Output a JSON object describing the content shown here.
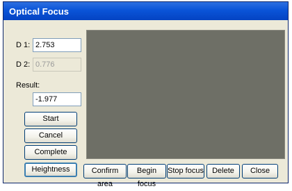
{
  "window": {
    "title": "Optical Focus"
  },
  "fields": {
    "d1": {
      "label": "D 1:",
      "value": "2.753"
    },
    "d2": {
      "label": "D 2:",
      "value": "0.776"
    },
    "result": {
      "label": "Result:",
      "value": "-1.977"
    }
  },
  "side_buttons": {
    "start": "Start",
    "cancel": "Cancel",
    "complete": "Complete",
    "heightness": "Heightness"
  },
  "bottom_buttons": {
    "confirm_area": "Confirm area",
    "begin_focus": "Begin focus",
    "stop_focus": "Stop focus",
    "delete": "Delete",
    "close": "Close"
  },
  "colors": {
    "titlebar": "#0a54d8",
    "dialog_bg": "#ece9d8",
    "view_bg": "#6e6f66"
  }
}
